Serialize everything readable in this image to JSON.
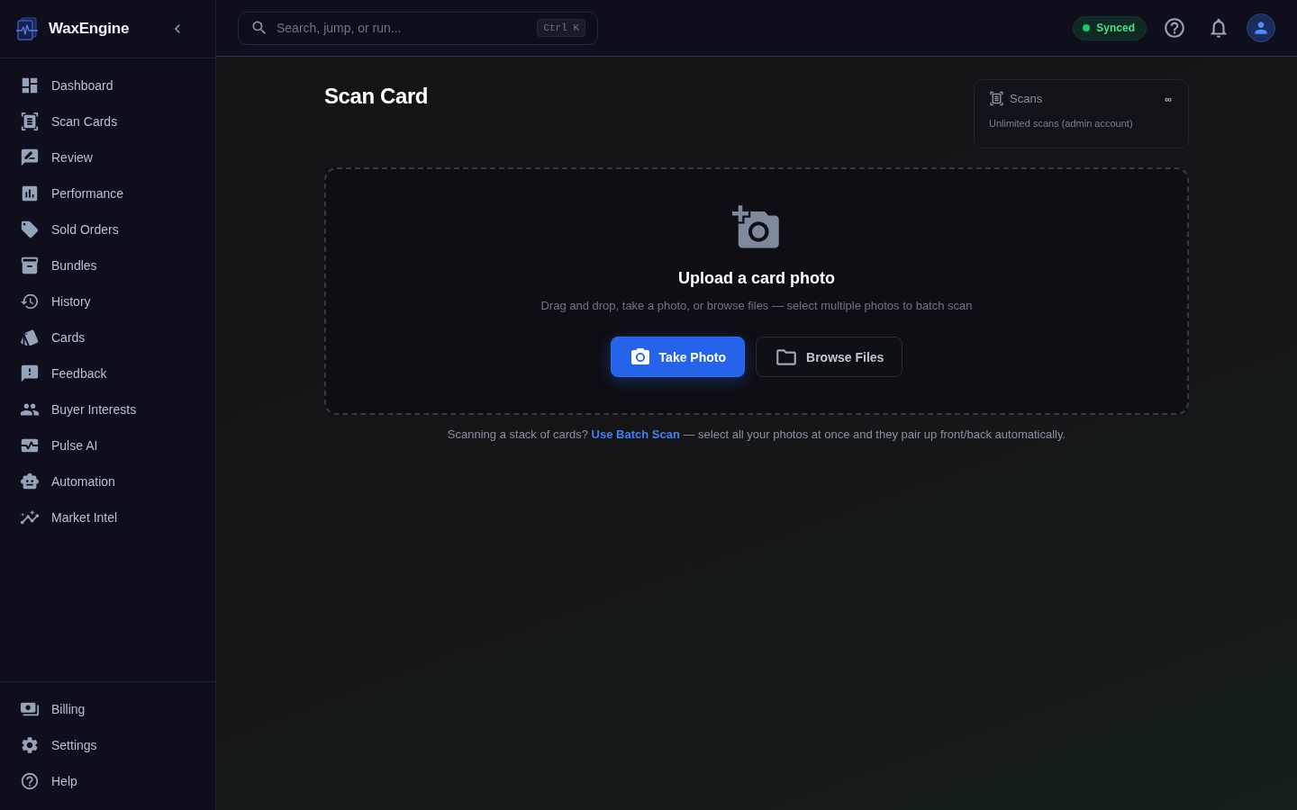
{
  "sidebar": {
    "brand": "WaxEngine",
    "nav": [
      {
        "label": "Dashboard",
        "selected": false
      },
      {
        "label": "Scan Cards",
        "selected": false
      },
      {
        "label": "Review",
        "selected": false
      },
      {
        "label": "Performance",
        "selected": false
      },
      {
        "label": "Sold Orders",
        "selected": false
      },
      {
        "label": "Bundles",
        "selected": false
      },
      {
        "label": "History",
        "selected": false
      },
      {
        "label": "Cards",
        "selected": false
      },
      {
        "label": "Feedback",
        "selected": false
      },
      {
        "label": "Buyer Interests",
        "selected": false
      },
      {
        "label": "Pulse AI",
        "selected": false
      },
      {
        "label": "Automation",
        "selected": false
      },
      {
        "label": "Market Intel",
        "selected": false
      }
    ],
    "footer_nav": [
      {
        "label": "Billing",
        "selected": false
      },
      {
        "label": "Settings",
        "selected": false
      },
      {
        "label": "Help",
        "selected": false
      }
    ]
  },
  "header": {
    "search": {
      "placeholder": "Search, jump, or run...",
      "shortcut": "Ctrl K"
    },
    "sync_status": {
      "label": "Synced"
    }
  },
  "page": {
    "title": "Scan Card",
    "scans_card": {
      "title": "Scans",
      "count": "∞",
      "note": "Unlimited scans (admin account)"
    },
    "dropzone": {
      "title": "Upload a card photo",
      "subtitle": "Drag and drop, take a photo, or browse files — select multiple photos to batch scan",
      "buttons": [
        {
          "label": "Take Photo",
          "kind": "primary"
        },
        {
          "label": "Browse Files",
          "kind": "secondary"
        }
      ]
    },
    "batch_hint": {
      "before": "Scanning a stack of cards?",
      "link": "Use Batch Scan",
      "after": "— select all your photos at once and they pair up front/back automatically."
    }
  }
}
